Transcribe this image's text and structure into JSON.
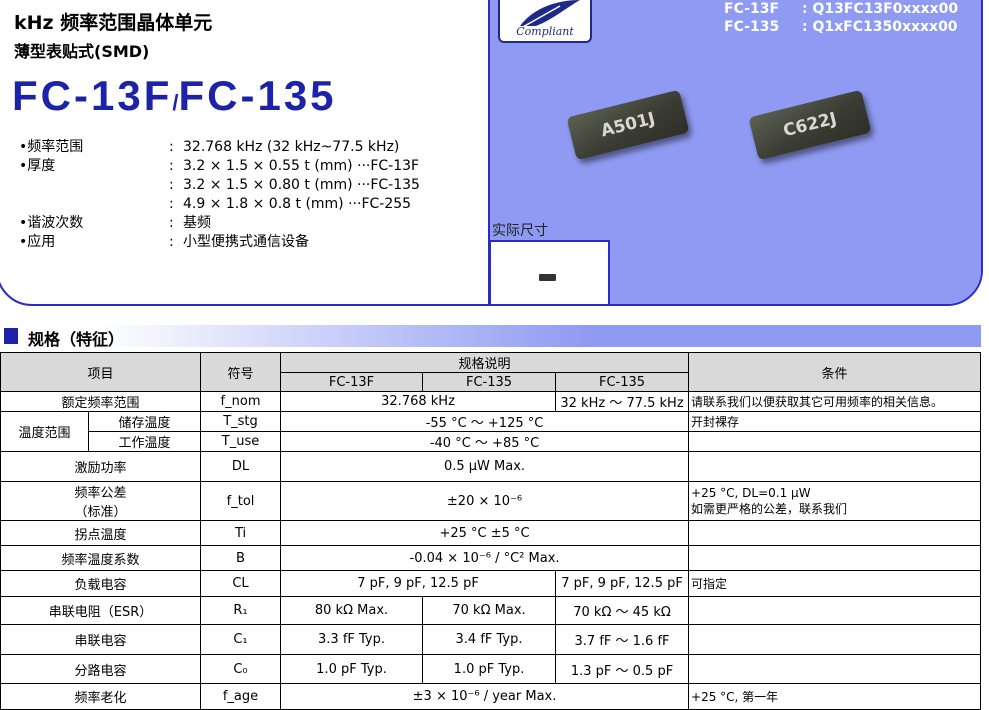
{
  "header": {
    "title": "kHz 频率范围晶体单元",
    "subtitle": "薄型表贴式(SMD)",
    "model_a": "FC-13F",
    "model_sep": "/",
    "model_b": "FC-135"
  },
  "features": [
    {
      "label": "•频率范围",
      "value": "32.768 kHz (32 kHz~77.5 kHz)"
    },
    {
      "label": "•厚度",
      "value": "3.2 × 1.5 × 0.55 t (mm) ···FC-13F"
    },
    {
      "label": "",
      "value": "3.2 × 1.5 × 0.80 t (mm) ···FC-135"
    },
    {
      "label": "",
      "value": "4.9 × 1.8 × 0.8 t (mm) ···FC-255"
    },
    {
      "label": "•谐波次数",
      "value": "基频"
    },
    {
      "label": "•应用",
      "value": "小型便携式通信设备"
    }
  ],
  "colon": ":",
  "logo_text": "Compliant",
  "part_numbers": [
    {
      "model": "FC-13F",
      "code": ": Q13FC13F0xxxx00"
    },
    {
      "model": "FC-135",
      "code": ": Q1xFC1350xxxx00"
    }
  ],
  "chips": [
    "A501J",
    "C622J"
  ],
  "actual_size_label": "实际尺寸",
  "section_title": "规格（特征）",
  "table": {
    "h_item": "项目",
    "h_symbol": "符号",
    "h_spec": "规格说明",
    "h_cond": "条件",
    "h_m1": "FC-13F",
    "h_m2": "FC-135",
    "h_m3": "FC-135",
    "freq_range": {
      "item": "额定频率范围",
      "sym": "f_nom",
      "v12": "32.768 kHz",
      "v3": "32 kHz ～ 77.5 kHz",
      "cond": "请联系我们以便获取其它可用频率的相关信息。"
    },
    "temp_group": "温度范围",
    "storage": {
      "item": "储存温度",
      "sym": "T_stg",
      "v": "-55 °C ～ +125 °C",
      "cond": "开封裸存"
    },
    "operating": {
      "item": "工作温度",
      "sym": "T_use",
      "v": "-40 °C ～ +85 °C",
      "cond": ""
    },
    "drive": {
      "item": "激励功率",
      "sym": "DL",
      "v": "0.5 µW Max.",
      "cond": ""
    },
    "tol": {
      "item_a": "频率公差",
      "item_b": "（标准）",
      "sym": "f_tol",
      "v": "±20 × 10⁻⁶",
      "cond_a": "+25 °C, DL=0.1 µW",
      "cond_b": "如需更严格的公差，联系我们"
    },
    "turnover": {
      "item": "拐点温度",
      "sym": "Ti",
      "v": "+25 °C ±5 °C",
      "cond": ""
    },
    "coef": {
      "item": "频率温度系数",
      "sym": "B",
      "v": "-0.04 × 10⁻⁶ / °C² Max.",
      "cond": ""
    },
    "load": {
      "item": "负载电容",
      "sym": "CL",
      "v12": "7 pF, 9 pF, 12.5 pF",
      "v3": "7 pF, 9 pF, 12.5 pF",
      "cond": "可指定"
    },
    "esr": {
      "item": "串联电阻（ESR）",
      "sym": "R₁",
      "v1": "80 kΩ Max.",
      "v2": "70 kΩ Max.",
      "v3": "70 kΩ ～ 45 kΩ",
      "cond": ""
    },
    "motional": {
      "item": "串联电容",
      "sym": "C₁",
      "v1": "3.3 fF Typ.",
      "v2": "3.4 fF Typ.",
      "v3": "3.7 fF ～ 1.6 fF",
      "cond": ""
    },
    "shunt": {
      "item": "分路电容",
      "sym": "C₀",
      "v1": "1.0 pF Typ.",
      "v2": "1.0 pF Typ.",
      "v3": "1.3 pF ～ 0.5 pF",
      "cond": ""
    },
    "aging": {
      "item": "频率老化",
      "sym": "f_age",
      "v": "±3 × 10⁻⁶ / year Max.",
      "cond": "+25 °C, 第一年"
    }
  }
}
